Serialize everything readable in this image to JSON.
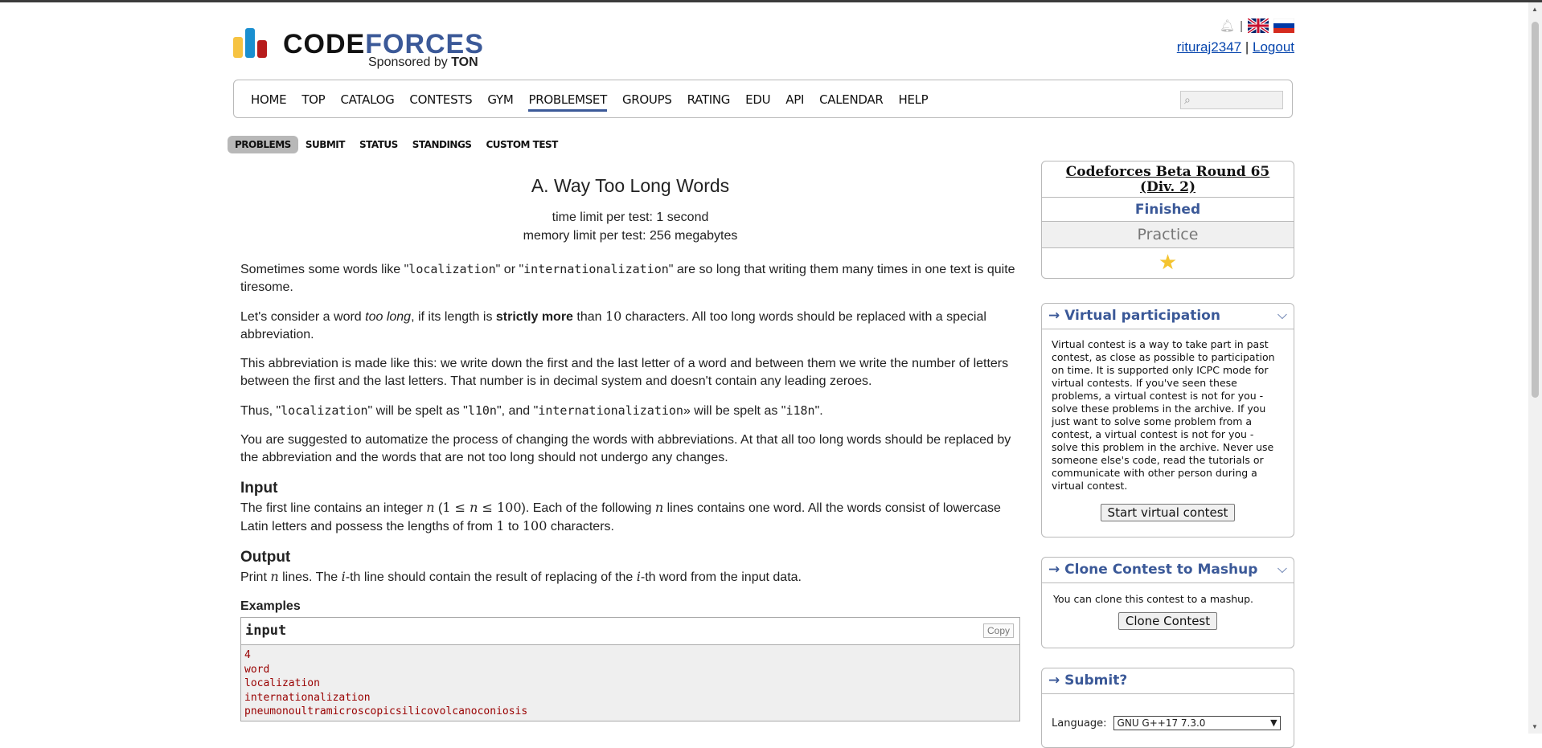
{
  "header": {
    "logo_text_code": "CODE",
    "logo_text_forces": "FORCES",
    "sponsor_prefix": "Sponsored by",
    "sponsor_name": "TON",
    "user": "rituraj2347",
    "separator": "|",
    "logout": "Logout"
  },
  "nav": {
    "items": [
      "HOME",
      "TOP",
      "CATALOG",
      "CONTESTS",
      "GYM",
      "PROBLEMSET",
      "GROUPS",
      "RATING",
      "EDU",
      "API",
      "CALENDAR",
      "HELP"
    ],
    "active": "PROBLEMSET"
  },
  "second_menu": [
    "PROBLEMS",
    "SUBMIT",
    "STATUS",
    "STANDINGS",
    "CUSTOM TEST"
  ],
  "problem": {
    "title": "A. Way Too Long Words",
    "time_limit": "time limit per test: 1 second",
    "memory_limit": "memory limit per test: 256 megabytes",
    "p1_a": "Sometimes some words like \"",
    "p1_code1": "localization",
    "p1_b": "\" or \"",
    "p1_code2": "internationalization",
    "p1_c": "\" are so long that writing them many times in one text is quite tiresome.",
    "p2_a": "Let's consider a word ",
    "p2_em": "too long",
    "p2_b": ", if its length is ",
    "p2_strong": "strictly more",
    "p2_c": " than ",
    "p2_num": "10",
    "p2_d": " characters. All too long words should be replaced with a special abbreviation.",
    "p3": "This abbreviation is made like this: we write down the first and the last letter of a word and between them we write the number of letters between the first and the last letters. That number is in decimal system and doesn't contain any leading zeroes.",
    "p4_a": "Thus, \"",
    "p4_code1": "localization",
    "p4_b": "\" will be spelt as \"",
    "p4_code2": "l10n",
    "p4_c": "\", and \"",
    "p4_code3": "internationalization",
    "p4_d": "» will be spelt as \"",
    "p4_code4": "i18n",
    "p4_e": "\".",
    "p5": "You are suggested to automatize the process of changing the words with abbreviations. At that all too long words should be replaced by the abbreviation and the words that are not too long should not undergo any changes.",
    "input_title": "Input",
    "input_a": "The first line contains an integer ",
    "input_n1": "n",
    "input_b": " (",
    "input_range": "1 ≤ ",
    "input_n2": "n",
    "input_range2": " ≤ 100",
    "input_c": "). Each of the following ",
    "input_n3": "n",
    "input_d": " lines contains one word. All the words consist of lowercase Latin letters and possess the lengths of from ",
    "input_one": "1",
    "input_e": " to ",
    "input_hundred": "100",
    "input_f": " characters.",
    "output_title": "Output",
    "output_a": "Print ",
    "output_n": "n",
    "output_b": " lines. The ",
    "output_i1": "i",
    "output_c": "-th line should contain the result of replacing of the ",
    "output_i2": "i",
    "output_d": "-th word from the input data.",
    "examples_title": "Examples",
    "sample_label": "input",
    "copy_label": "Copy",
    "sample_lines": [
      "4",
      "word",
      "localization",
      "internationalization",
      "pneumonoultramicroscopicsilicovolcanoconiosis"
    ]
  },
  "sidebar": {
    "contest_name": "Codeforces Beta Round 65 (Div. 2)",
    "status": "Finished",
    "mode": "Practice",
    "star_icon": "star-icon",
    "vp_title": "→ Virtual participation",
    "vp_text": "Virtual contest is a way to take part in past contest, as close as possible to participation on time. It is supported only ICPC mode for virtual contests. If you've seen these problems, a virtual contest is not for you - solve these problems in the archive. If you just want to solve some problem from a contest, a virtual contest is not for you - solve this problem in the archive. Never use someone else's code, read the tutorials or communicate with other person during a virtual contest.",
    "vp_button": "Start virtual contest",
    "clone_title": "→ Clone Contest to Mashup",
    "clone_text": "You can clone this contest to a mashup.",
    "clone_button": "Clone Contest",
    "submit_title": "→ Submit?",
    "language_label": "Language:",
    "language_value": "GNU G++17 7.3.0"
  },
  "colors": {
    "accent": "#3b5998",
    "logo_yellow": "#f6c342",
    "logo_blue": "#1a8fd0",
    "logo_red": "#b71c1c",
    "sample_text": "#990000"
  }
}
